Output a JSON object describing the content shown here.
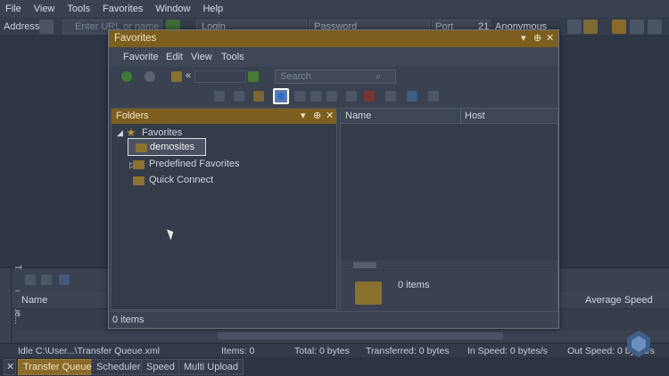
{
  "menubar": {
    "items": [
      "File",
      "View",
      "Tools",
      "Favorites",
      "Window",
      "Help"
    ]
  },
  "addressbar": {
    "address_label": "Address",
    "url_placeholder": "Enter URL or name",
    "login_label": "Login",
    "password_label": "Password",
    "port_label": "Port",
    "port_value": "21",
    "anonymous_label": "Anonymous"
  },
  "favorites_dialog": {
    "title": "Favorites",
    "menu": [
      "Favorite",
      "Edit",
      "View",
      "Tools"
    ],
    "nav_path": "«",
    "search_placeholder": "Search",
    "folders_pane_title": "Folders",
    "tree": {
      "root": "Favorites",
      "children": [
        "demosites",
        "Predefined Favorites",
        "Quick Connect"
      ]
    },
    "columns": [
      "Name",
      "Host"
    ],
    "items_info": "0 items",
    "status": "0 items"
  },
  "queue": {
    "vertical_tab": "Transfer Que...",
    "columns": [
      "Name",
      "Average Speed"
    ]
  },
  "statusbar": {
    "idle": "Idle   C:\\User...\\Transfer Queue.xml",
    "items": "Items: 0",
    "total": "Total: 0 bytes",
    "transferred": "Transferred: 0 bytes",
    "in_speed": "In Speed: 0 bytes/s",
    "out_speed": "Out Speed: 0 bytes/s"
  },
  "bottom_tabs": [
    "Transfer Queue",
    "Scheduler",
    "Speed",
    "Multi Upload"
  ],
  "colors": {
    "accent": "#7c5f1f",
    "background": "#2f3747",
    "highlight": "#ffffff"
  }
}
